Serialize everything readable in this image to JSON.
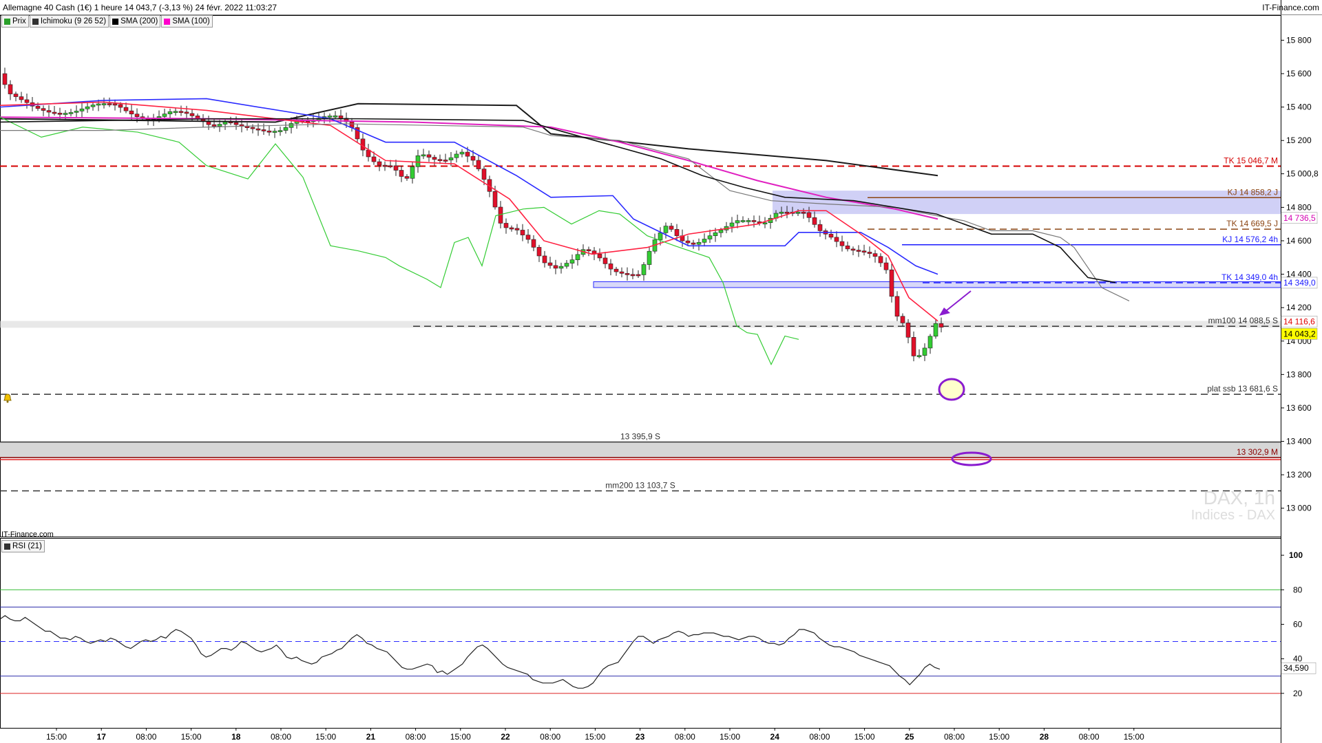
{
  "header": {
    "title": "Allemagne 40 Cash (1€) 1 heure 14 043,7 (-3,13 %) 24 févr. 2022 11:03:27",
    "source": "IT-Finance.com"
  },
  "legend": [
    {
      "label": "Prix",
      "color": "#2aa02a"
    },
    {
      "label": "Ichimoku (9 26 52)",
      "color": "#333333"
    },
    {
      "label": "SMA (200)",
      "color": "#000000"
    },
    {
      "label": "SMA (100)",
      "color": "#ff00cc"
    }
  ],
  "rsi_legend": "RSI (21)",
  "watermark": {
    "symbol": "DAX, 1h",
    "sub": "Indices - DAX"
  },
  "footer_source": "IT-Finance.com",
  "chart_data": {
    "type": "candlestick",
    "price_axis": {
      "range": [
        12830,
        15950
      ],
      "ticks": [
        "15 800",
        "15 600",
        "15 400",
        "15 200",
        "15 000,8",
        "14 800",
        "14 600",
        "14 400",
        "14 200",
        "14 000",
        "13 800",
        "13 600",
        "13 400",
        "13 200",
        "13 000"
      ],
      "tick_values": [
        15800,
        15600,
        15400,
        15200,
        15000.8,
        14800,
        14600,
        14400,
        14200,
        14000,
        13800,
        13600,
        13400,
        13200,
        13000
      ]
    },
    "time_axis": {
      "labels": [
        "15:00",
        "17",
        "08:00",
        "15:00",
        "18",
        "08:00",
        "15:00",
        "21",
        "08:00",
        "15:00",
        "22",
        "08:00",
        "15:00",
        "23",
        "08:00",
        "15:00",
        "24",
        "08:00",
        "15:00",
        "25",
        "08:00",
        "15:00",
        "28",
        "08:00",
        "15:00"
      ],
      "bold": [
        "17",
        "18",
        "21",
        "22",
        "23",
        "24",
        "25",
        "28"
      ]
    },
    "levels": [
      {
        "label": "TK 15 046,7 M",
        "value": 15046.7,
        "color": "#d40000",
        "style": "dash",
        "align": "right"
      },
      {
        "label": "KJ 14 858,2 J",
        "value": 14858.2,
        "color": "#8b4513",
        "style": "solid",
        "align": "right"
      },
      {
        "label": "TK 14 669,5 J",
        "value": 14669.5,
        "color": "#8b4513",
        "style": "dash",
        "align": "right"
      },
      {
        "label": "KJ 14 576,2 4h",
        "value": 14576.2,
        "color": "#1a1aff",
        "style": "solid",
        "align": "right"
      },
      {
        "label": "TK 14 349,0 4h",
        "value": 14349.0,
        "color": "#1a1aff",
        "style": "dash",
        "align": "right"
      },
      {
        "label": "mm100 14 088,5 S",
        "value": 14088.5,
        "color": "#333333",
        "style": "dash",
        "align": "right"
      },
      {
        "label": "plat ssb 13 681,6 S",
        "value": 13681.6,
        "color": "#333333",
        "style": "dash",
        "align": "right"
      },
      {
        "label": "13 395,9 S",
        "value": 13395.9,
        "color": "#333333",
        "style": "solid",
        "align": "center"
      },
      {
        "label": "13 302,9 M",
        "value": 13302.9,
        "color": "#8b0000",
        "style": "solid",
        "align": "right"
      },
      {
        "label": "mm200 13 103,7 S",
        "value": 13103.7,
        "color": "#333333",
        "style": "dash",
        "align": "center"
      }
    ],
    "badges": [
      {
        "label": "14 736,5",
        "value": 14736.5,
        "color": "#d400b0",
        "bg": "#ffffff"
      },
      {
        "label": "14 349,0",
        "value": 14349.0,
        "color": "#1a1aff",
        "bg": "#ffffff"
      },
      {
        "label": "14 116,6",
        "value": 14116.6,
        "color": "#e00000",
        "bg": "#ffffff"
      },
      {
        "label": "14 043,2",
        "value": 14043.2,
        "color": "#000000",
        "bg": "#ffff00"
      }
    ],
    "rsi": {
      "range": [
        0,
        110
      ],
      "ticks": [
        100,
        80,
        60,
        40,
        20
      ],
      "value_label": "34,590",
      "values": [
        63,
        65,
        63,
        62,
        62,
        64,
        62,
        60,
        58,
        56,
        56,
        54,
        52,
        52,
        51,
        53,
        52,
        50,
        49,
        50,
        51,
        50,
        52,
        51,
        49,
        47,
        46,
        48,
        50,
        51,
        50,
        51,
        53,
        52,
        55,
        57,
        56,
        54,
        52,
        48,
        43,
        41,
        42,
        44,
        46,
        46,
        45,
        47,
        50,
        49,
        47,
        45,
        44,
        45,
        46,
        48,
        45,
        41,
        40,
        41,
        39,
        38,
        37,
        38,
        41,
        42,
        43,
        45,
        46,
        49,
        52,
        54,
        52,
        49,
        48,
        46,
        45,
        44,
        41,
        38,
        35,
        34,
        34,
        35,
        36,
        37,
        36,
        32,
        33,
        31,
        33,
        35,
        37,
        41,
        44,
        47,
        48,
        46,
        43,
        40,
        37,
        35,
        34,
        33,
        32,
        31,
        28,
        27,
        26,
        26,
        26,
        27,
        28,
        26,
        24,
        23,
        23,
        24,
        26,
        30,
        34,
        36,
        37,
        38,
        42,
        46,
        50,
        53,
        53,
        51,
        49,
        51,
        52,
        53,
        55,
        56,
        55,
        53,
        54,
        54,
        55,
        55,
        55,
        54,
        53,
        53,
        52,
        51,
        52,
        53,
        53,
        52,
        50,
        49,
        49,
        48,
        49,
        52,
        54,
        57,
        57,
        56,
        55,
        52,
        50,
        48,
        47,
        47,
        46,
        45,
        44,
        42,
        41,
        40,
        39,
        38,
        37,
        36,
        33,
        30,
        28,
        25,
        28,
        31,
        35,
        37,
        35,
        34
      ]
    }
  }
}
